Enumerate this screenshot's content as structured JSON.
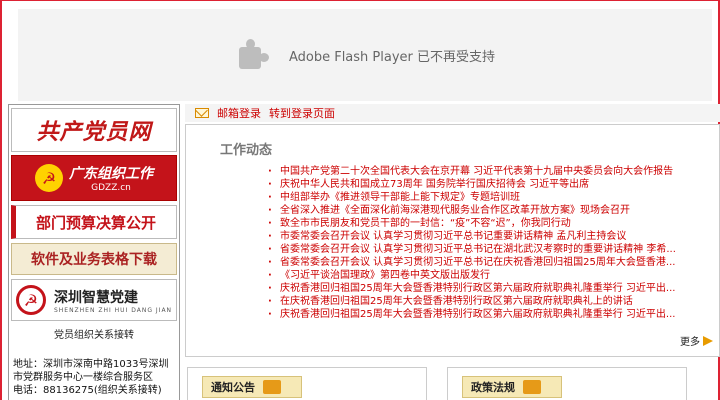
{
  "flash": {
    "text": "Adobe Flash Player 已不再受支持"
  },
  "left": {
    "banner1": "共产党员网",
    "banner2_title": "广东组织工作",
    "banner2_sub": "GDZZ.cn",
    "banner3": "部门预算决算公开",
    "banner4": "软件及业务表格下载",
    "banner5_title": "深圳智慧党建",
    "banner5_sub": "SHENZHEN ZHI HUI DANG JIAN",
    "transfer": "党员组织关系接转",
    "address_lines": [
      "地址：深圳市深南中路1033号深圳",
      "市党群服务中心一楼综合服务区",
      "电话：88136275(组织关系接转)"
    ]
  },
  "mailbar": {
    "mail_link": "邮箱登录",
    "login_link": "转到登录页面"
  },
  "news": {
    "title": "工作动态",
    "items": [
      "中国共产党第二十次全国代表大会在京开幕 习近平代表第十九届中央委员会向大会作报告",
      "庆祝中华人民共和国成立73周年 国务院举行国庆招待会 习近平等出席",
      "中组部举办《推进领导干部能上能下规定》专题培训班",
      "全省深入推进《全面深化前海深港现代服务业合作区改革开放方案》现场会召开",
      "致全市市民朋友和党员干部的一封信：“疫”不容“迟”，你我同行动",
      "市委常委会召开会议 认真学习贯彻习近平总书记重要讲话精神 孟凡利主持会议",
      "省委常委会召开会议 认真学习贯彻习近平总书记在湖北武汉考察时的重要讲话精神 李希...",
      "省委常委会召开会议 认真学习贯彻习近平总书记在庆祝香港回归祖国25周年大会暨香港...",
      "《习近平谈治国理政》第四卷中英文版出版发行",
      "庆祝香港回归祖国25周年大会暨香港特别行政区第六届政府就职典礼隆重举行 习近平出...",
      "在庆祝香港回归祖国25周年大会暨香港特别行政区第六届政府就职典礼上的讲话",
      "庆祝香港回归祖国25周年大会暨香港特别行政区第六届政府就职典礼隆重举行 习近平出..."
    ],
    "more": "更多"
  },
  "boxes": {
    "notice": "通知公告",
    "policy": "政策法规"
  }
}
